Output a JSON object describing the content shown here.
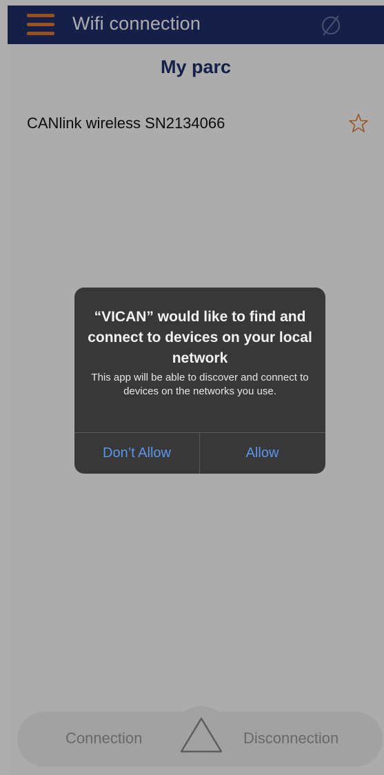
{
  "header": {
    "title": "Wifi connection",
    "menu_icon": "hamburger-menu-icon",
    "status_icon": "empty-set-icon",
    "background": "#1f2e6b",
    "accent": "#e07a2c"
  },
  "main": {
    "section_title": "My parc",
    "devices": [
      {
        "name": "CANlink wireless SN2134066",
        "favorite_icon": "star-outline-icon"
      }
    ]
  },
  "bottom_bar": {
    "connection_label": "Connection",
    "disconnection_label": "Disconnection",
    "center_icon": "triangle-up-icon"
  },
  "dialog": {
    "title": "“VICAN” would like to find and connect to devices on your local network",
    "message": "This app will be able to discover and connect to devices on the networks you use.",
    "deny_label": "Don’t Allow",
    "allow_label": "Allow",
    "button_color": "#5b95ee"
  }
}
